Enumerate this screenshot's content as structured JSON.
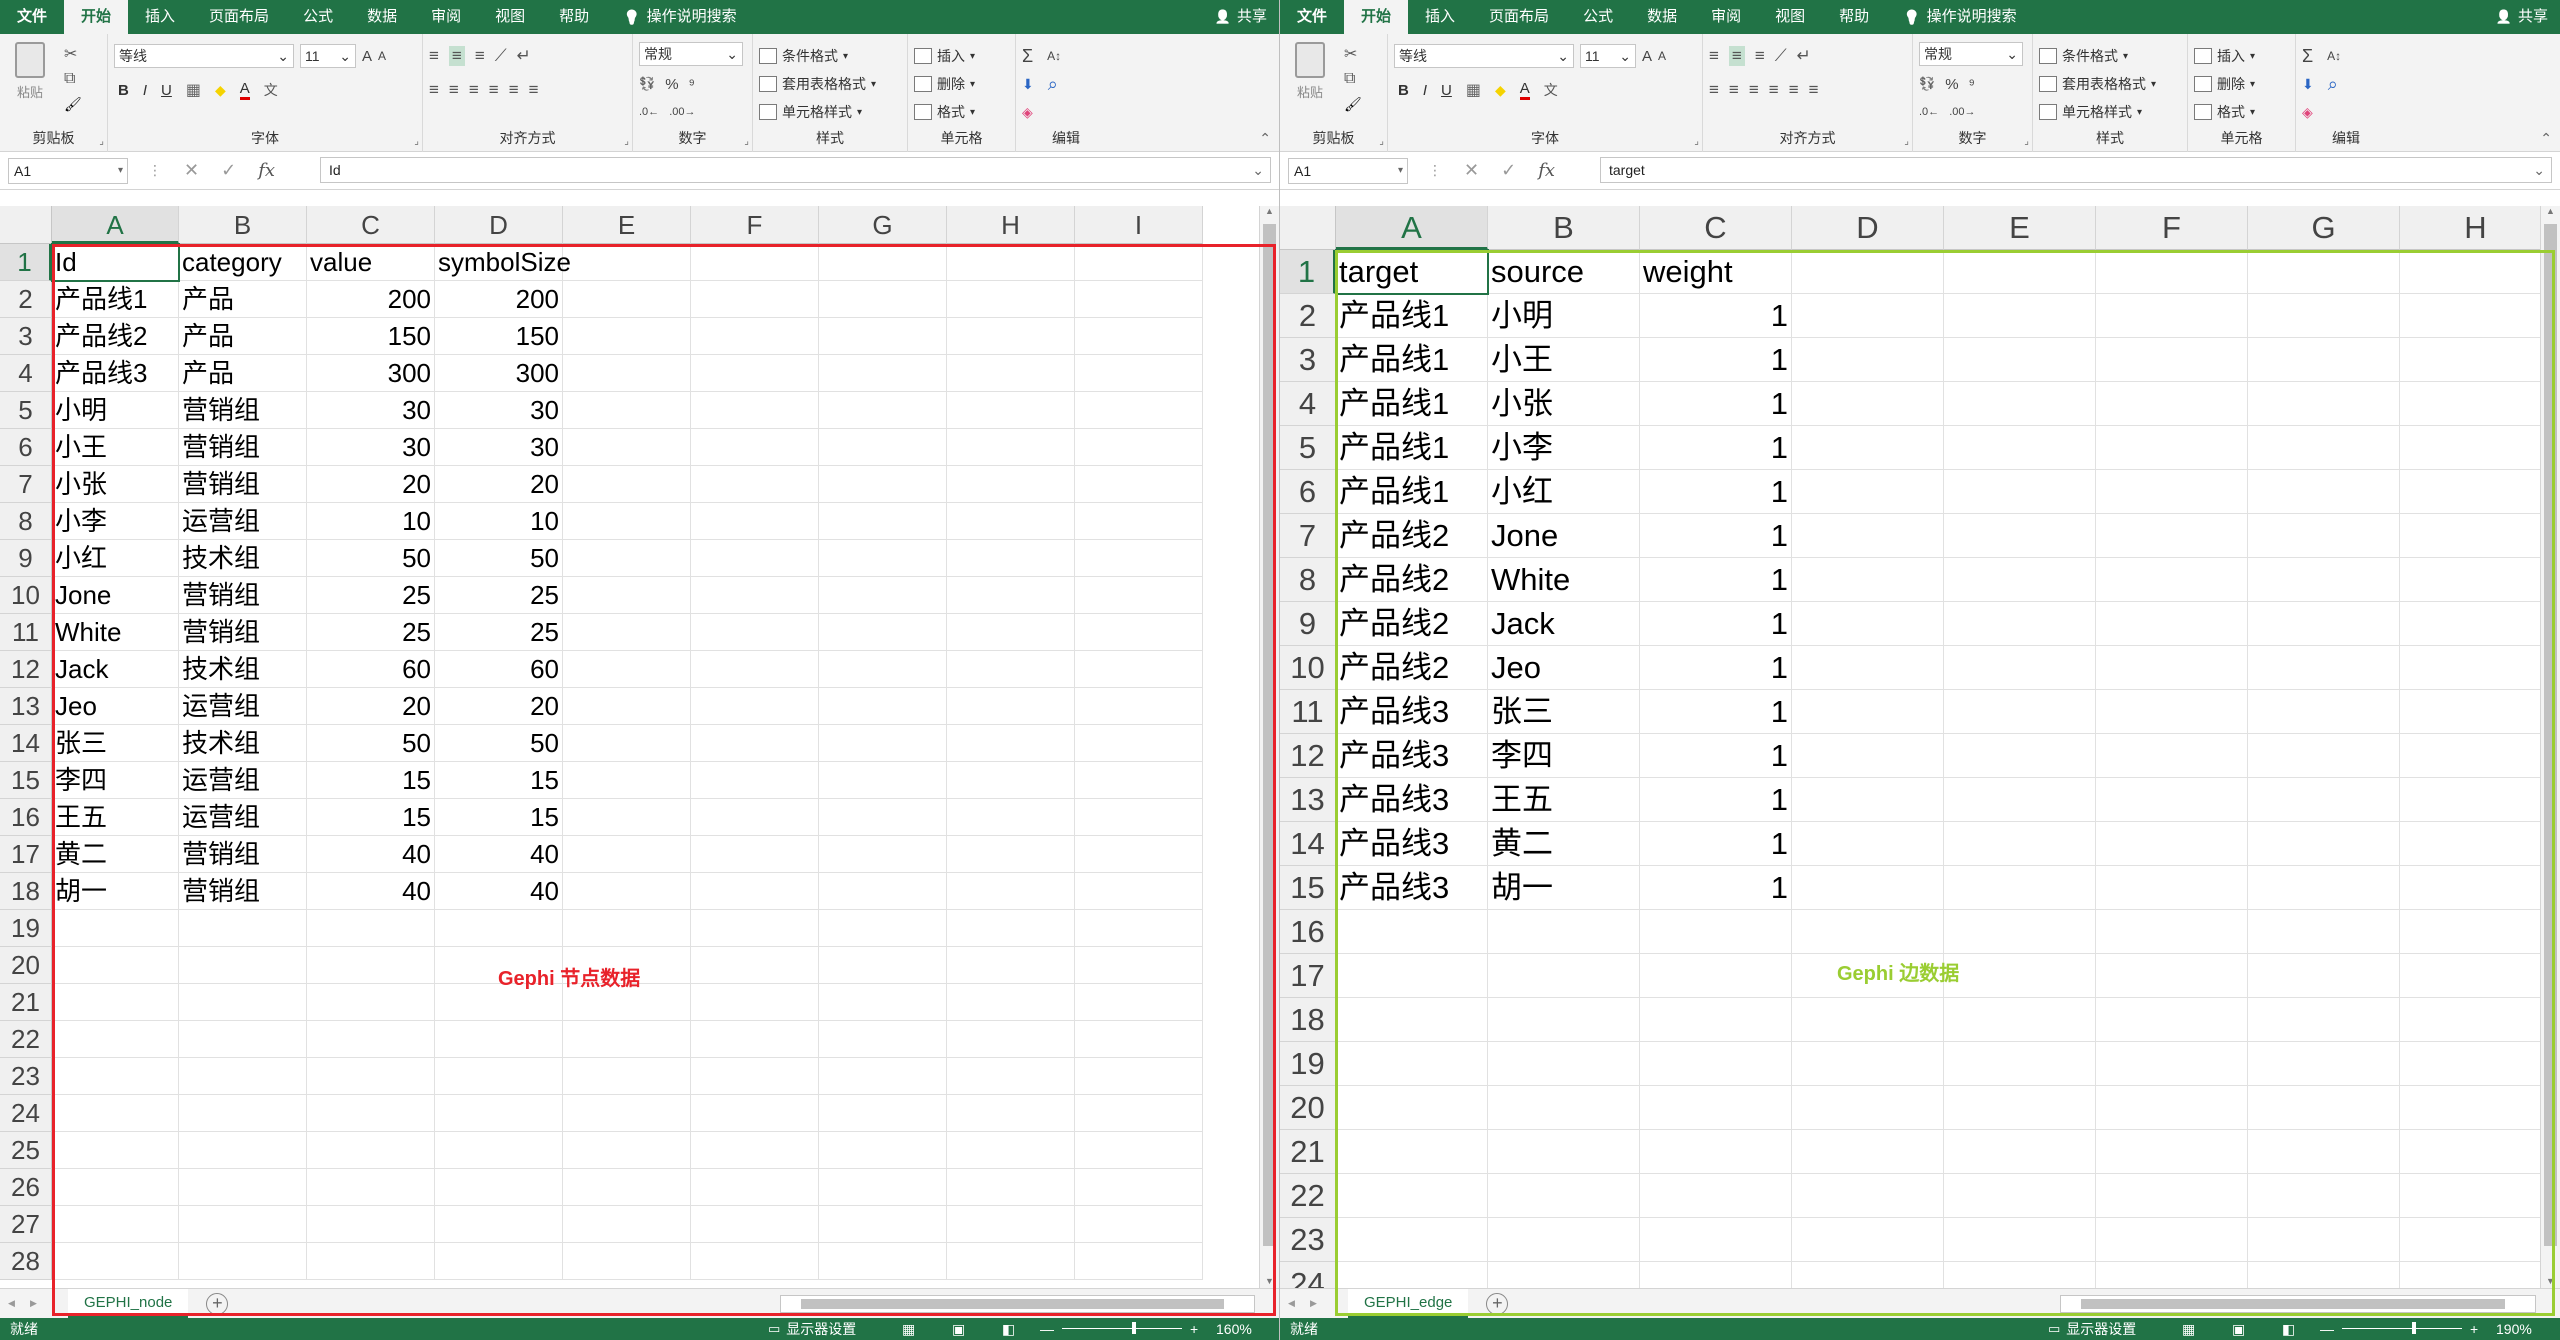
{
  "tabs": {
    "file": "文件",
    "home": "开始",
    "insert": "插入",
    "layout": "页面布局",
    "formulas": "公式",
    "data": "数据",
    "review": "审阅",
    "view": "视图",
    "help": "帮助",
    "tell": "操作说明搜索",
    "share": "共享"
  },
  "ribbon": {
    "clipboard_label": "剪贴板",
    "paste_label": "粘贴",
    "font_label": "字体",
    "font_name": "等线",
    "font_size": "11",
    "bold": "B",
    "italic": "I",
    "underline": "U",
    "grow": "A",
    "shrink": "A",
    "align_label": "对齐方式",
    "number_label": "数字",
    "number_format": "常规",
    "percent": "%",
    "styles_label": "样式",
    "cond_format": "条件格式",
    "table_format": "套用表格格式",
    "cell_styles": "单元格样式",
    "cells_label": "单元格",
    "insert": "插入",
    "delete": "删除",
    "format": "格式",
    "edit_label": "编辑",
    "sum": "Σ"
  },
  "status": {
    "ready": "就绪",
    "display_settings": "显示器设置"
  },
  "left": {
    "name_box": "A1",
    "formula": "Id",
    "sheet_tab": "GEPHI_node",
    "zoom": "160%",
    "columns": [
      "A",
      "B",
      "C",
      "D",
      "E",
      "F",
      "G",
      "H",
      "I"
    ],
    "rows": [
      "1",
      "2",
      "3",
      "4",
      "5",
      "6",
      "7",
      "8",
      "9",
      "10",
      "11",
      "12",
      "13",
      "14",
      "15",
      "16",
      "17",
      "18",
      "19",
      "20",
      "21",
      "22",
      "23",
      "24",
      "25",
      "26",
      "27",
      "28"
    ],
    "cells": [
      [
        "Id",
        "category",
        "value",
        "symbolSize"
      ],
      [
        "产品线1",
        "产品",
        "200",
        "200"
      ],
      [
        "产品线2",
        "产品",
        "150",
        "150"
      ],
      [
        "产品线3",
        "产品",
        "300",
        "300"
      ],
      [
        "小明",
        "营销组",
        "30",
        "30"
      ],
      [
        "小王",
        "营销组",
        "30",
        "30"
      ],
      [
        "小张",
        "营销组",
        "20",
        "20"
      ],
      [
        "小李",
        "运营组",
        "10",
        "10"
      ],
      [
        "小红",
        "技术组",
        "50",
        "50"
      ],
      [
        "Jone",
        "营销组",
        "25",
        "25"
      ],
      [
        "White",
        "营销组",
        "25",
        "25"
      ],
      [
        "Jack",
        "技术组",
        "60",
        "60"
      ],
      [
        "Jeo",
        "运营组",
        "20",
        "20"
      ],
      [
        "张三",
        "技术组",
        "50",
        "50"
      ],
      [
        "李四",
        "运营组",
        "15",
        "15"
      ],
      [
        "王五",
        "运营组",
        "15",
        "15"
      ],
      [
        "黄二",
        "营销组",
        "40",
        "40"
      ],
      [
        "胡一",
        "营销组",
        "40",
        "40"
      ]
    ],
    "annotation": "Gephi 节点数据",
    "frame_color": "#e8222a"
  },
  "right": {
    "name_box": "A1",
    "formula": "target",
    "sheet_tab": "GEPHI_edge",
    "zoom": "190%",
    "columns": [
      "A",
      "B",
      "C",
      "D",
      "E",
      "F",
      "G",
      "H"
    ],
    "rows": [
      "1",
      "2",
      "3",
      "4",
      "5",
      "6",
      "7",
      "8",
      "9",
      "10",
      "11",
      "12",
      "13",
      "14",
      "15",
      "16",
      "17",
      "18",
      "19",
      "20",
      "21",
      "22",
      "23",
      "24"
    ],
    "cells": [
      [
        "target",
        "source",
        "weight"
      ],
      [
        "产品线1",
        "小明",
        "1"
      ],
      [
        "产品线1",
        "小王",
        "1"
      ],
      [
        "产品线1",
        "小张",
        "1"
      ],
      [
        "产品线1",
        "小李",
        "1"
      ],
      [
        "产品线1",
        "小红",
        "1"
      ],
      [
        "产品线2",
        "Jone",
        "1"
      ],
      [
        "产品线2",
        "White",
        "1"
      ],
      [
        "产品线2",
        "Jack",
        "1"
      ],
      [
        "产品线2",
        "Jeo",
        "1"
      ],
      [
        "产品线3",
        "张三",
        "1"
      ],
      [
        "产品线3",
        "李四",
        "1"
      ],
      [
        "产品线3",
        "王五",
        "1"
      ],
      [
        "产品线3",
        "黄二",
        "1"
      ],
      [
        "产品线3",
        "胡一",
        "1"
      ]
    ],
    "annotation": "Gephi 边数据",
    "frame_color": "#9acd32"
  }
}
